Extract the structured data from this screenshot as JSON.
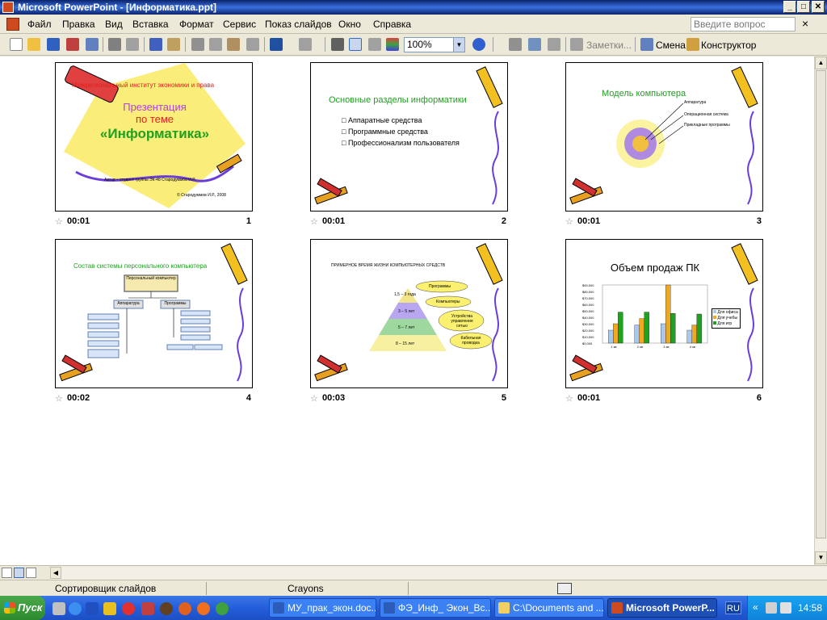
{
  "window": {
    "title": "Microsoft PowerPoint - [Информатика.ppt]",
    "min": "_",
    "max": "□",
    "close": "✕"
  },
  "menu": {
    "items": [
      "Файл",
      "Правка",
      "Вид",
      "Вставка",
      "Формат",
      "Сервис",
      "Показ слайдов",
      "Окно",
      "Справка"
    ],
    "help_placeholder": "Введите вопрос",
    "close": "×"
  },
  "toolbar": {
    "zoom": "100%",
    "notes": "Заметки...",
    "transition": "Смена",
    "designer": "Конструктор"
  },
  "slides": [
    {
      "num": "1",
      "time": "00:01",
      "institute": "Межрегиональный институт экономики и права",
      "title_line1": "Презентация",
      "title_line2": "по теме",
      "title_line3": "«Информатика»",
      "author": "Автор – студент группы ЭК-48 Стародуммов И.Р.",
      "copyright": "© Стародуммов И.Р., 2008"
    },
    {
      "num": "2",
      "time": "00:01",
      "title": "Основные разделы информатики",
      "bullets": [
        "Аппаратные средства",
        "Программные средства",
        "Профессионализм пользователя"
      ]
    },
    {
      "num": "3",
      "time": "00:01",
      "title": "Модель компьютера",
      "labels": [
        "Аппаратура",
        "Операционная система",
        "Прикладные программы"
      ]
    },
    {
      "num": "4",
      "time": "00:02",
      "title": "Состав системы персонального компьютера",
      "root": "Персональный компьютер",
      "left": "Аппаратура",
      "right": "Программы"
    },
    {
      "num": "5",
      "time": "00:03",
      "title": "ПРИМЕРНОЕ ВРЕМЯ ЖИЗНИ КОМПЬЮТЕРНЫХ СРЕДСТВ",
      "levels": [
        "1,5 – 3 года",
        "3 – 5 лет",
        "5 – 7 лет",
        "8 – 15 лет"
      ],
      "bubbles": [
        "Программы",
        "Компьютеры",
        "Устройства управления сетью",
        "Кабельная проводка"
      ]
    },
    {
      "num": "6",
      "time": "00:01",
      "title": "Объем продаж ПК",
      "yticks": [
        "$90,000",
        "$80,000",
        "$70,000",
        "$60,000",
        "$50,000",
        "$40,000",
        "$30,000",
        "$20,000",
        "$10,000",
        "$0,000"
      ],
      "xticks": [
        "1 кв",
        "2 кв",
        "3 кв",
        "4 кв"
      ],
      "legend": [
        "Для офиса",
        "Для учебы",
        "Для игр"
      ]
    }
  ],
  "chart_data": {
    "type": "bar",
    "title": "Объем продаж ПК",
    "categories": [
      "1 кв",
      "2 кв",
      "3 кв",
      "4 кв"
    ],
    "series": [
      {
        "name": "Для офиса",
        "values": [
          20000,
          28000,
          30000,
          20000
        ],
        "color": "#a9c8ec"
      },
      {
        "name": "Для учебы",
        "values": [
          30000,
          38000,
          90000,
          28000
        ],
        "color": "#f2a81e"
      },
      {
        "name": "Для игр",
        "values": [
          48000,
          48000,
          46000,
          45000
        ],
        "color": "#22a022"
      }
    ],
    "ylim": [
      0,
      90000
    ]
  },
  "statusbar": {
    "view": "Сортировщик слайдов",
    "design": "Crayons"
  },
  "taskbar": {
    "start": "Пуск",
    "tasks": [
      "МУ_прак_экон.doc...",
      "ФЭ_Инф_ Экон_Вс...",
      "C:\\Documents and ...",
      "Microsoft PowerP..."
    ],
    "lang": "RU",
    "expand": "«",
    "time": "14:58"
  }
}
